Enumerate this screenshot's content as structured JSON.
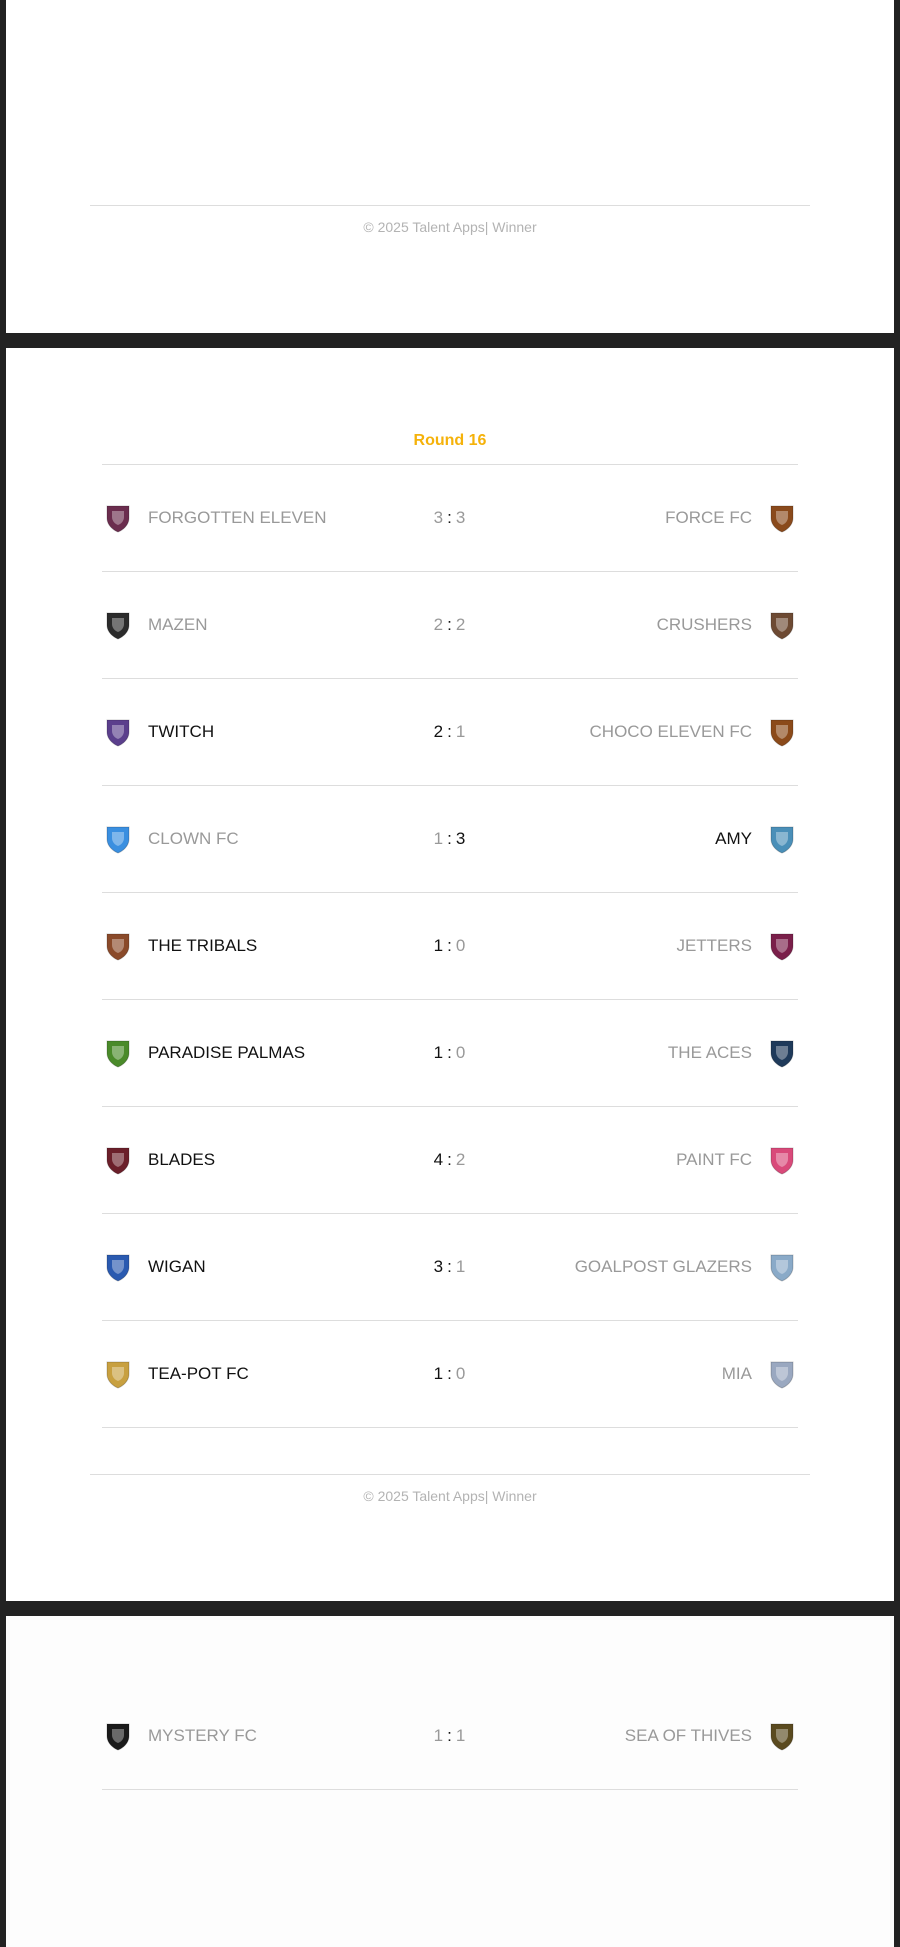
{
  "footer": {
    "text": "© 2025 Talent Apps| Winner"
  },
  "round": {
    "title": "Round 16"
  },
  "matches": [
    {
      "home": "FORGOTTEN ELEVEN",
      "home_score": "3",
      "away_score": "3",
      "away": "FORCE FC",
      "home_icon": "forgotten-eleven-crest-icon",
      "away_icon": "force-fc-crest-icon",
      "home_color": "#6b2d4e",
      "away_color": "#8a4a1c"
    },
    {
      "home": "MAZEN",
      "home_score": "2",
      "away_score": "2",
      "away": "CRUSHERS",
      "home_icon": "mazen-crest-icon",
      "away_icon": "crushers-crest-icon",
      "home_color": "#2b2b2b",
      "away_color": "#6d4a33"
    },
    {
      "home": "TWITCH",
      "home_score": "2",
      "away_score": "1",
      "away": "CHOCO ELEVEN FC",
      "home_icon": "twitch-crest-icon",
      "away_icon": "choco-eleven-fc-crest-icon",
      "home_color": "#5b3f8c",
      "away_color": "#8b4a1a"
    },
    {
      "home": "CLOWN FC",
      "home_score": "1",
      "away_score": "3",
      "away": "AMY",
      "home_icon": "clown-fc-crest-icon",
      "away_icon": "amy-crest-icon",
      "home_color": "#3a8fe0",
      "away_color": "#4a8fb8"
    },
    {
      "home": "THE TRIBALS",
      "home_score": "1",
      "away_score": "0",
      "away": "JETTERS",
      "home_icon": "the-tribals-crest-icon",
      "away_icon": "jetters-crest-icon",
      "home_color": "#8a4a2a",
      "away_color": "#7a1f4a"
    },
    {
      "home": "PARADISE PALMAS",
      "home_score": "1",
      "away_score": "0",
      "away": "THE ACES",
      "home_icon": "paradise-palmas-crest-icon",
      "away_icon": "the-aces-crest-icon",
      "home_color": "#4a8a2a",
      "away_color": "#1f3a5a"
    },
    {
      "home": "BLADES",
      "home_score": "4",
      "away_score": "2",
      "away": "PAINT FC",
      "home_icon": "blades-crest-icon",
      "away_icon": "paint-fc-crest-icon",
      "home_color": "#6b1f2a",
      "away_color": "#d94a7a"
    },
    {
      "home": "WIGAN",
      "home_score": "3",
      "away_score": "1",
      "away": "GOALPOST GLAZERS",
      "home_icon": "wigan-crest-icon",
      "away_icon": "goalpost-glazers-crest-icon",
      "home_color": "#2a5ab0",
      "away_color": "#8aaac8"
    },
    {
      "home": "TEA-POT FC",
      "home_score": "1",
      "away_score": "0",
      "away": "MIA",
      "home_icon": "tea-pot-fc-crest-icon",
      "away_icon": "mia-crest-icon",
      "home_color": "#c8a040",
      "away_color": "#9aa8c0"
    }
  ],
  "next_page_matches": [
    {
      "home": "MYSTERY FC",
      "home_score": "1",
      "away_score": "1",
      "away": "SEA OF THIVES",
      "home_icon": "mystery-fc-crest-icon",
      "away_icon": "sea-of-thives-crest-icon",
      "home_color": "#1a1a1a",
      "away_color": "#5a4a1f"
    }
  ]
}
